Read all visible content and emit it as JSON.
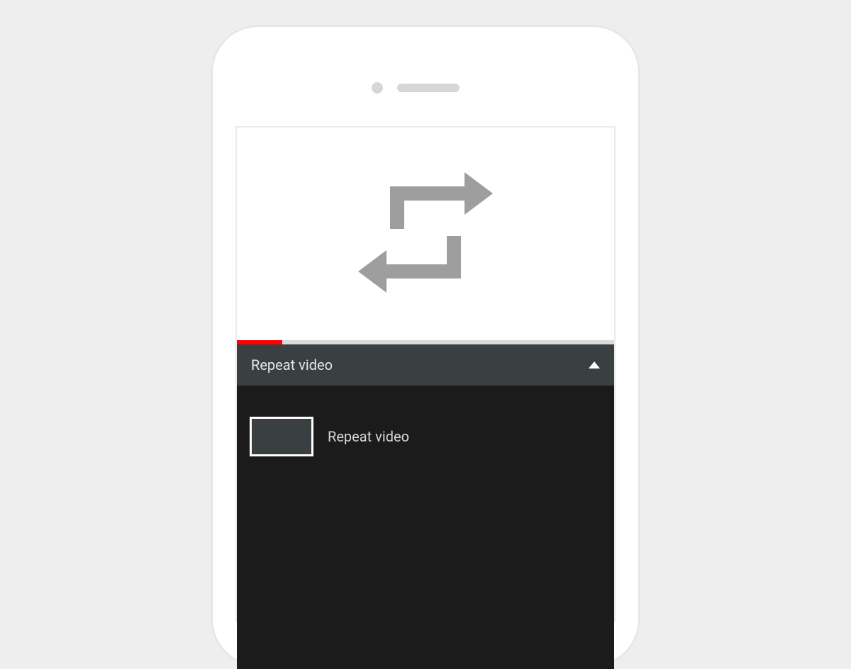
{
  "video": {
    "progress_percent": 12
  },
  "panel": {
    "header_label": "Repeat video"
  },
  "playlist": {
    "items": [
      {
        "label": "Repeat video"
      }
    ]
  },
  "colors": {
    "accent_red": "#ff0000",
    "panel_gray": "#3a3f42",
    "playlist_black": "#1b1b1b",
    "icon_gray": "#9e9e9e"
  }
}
